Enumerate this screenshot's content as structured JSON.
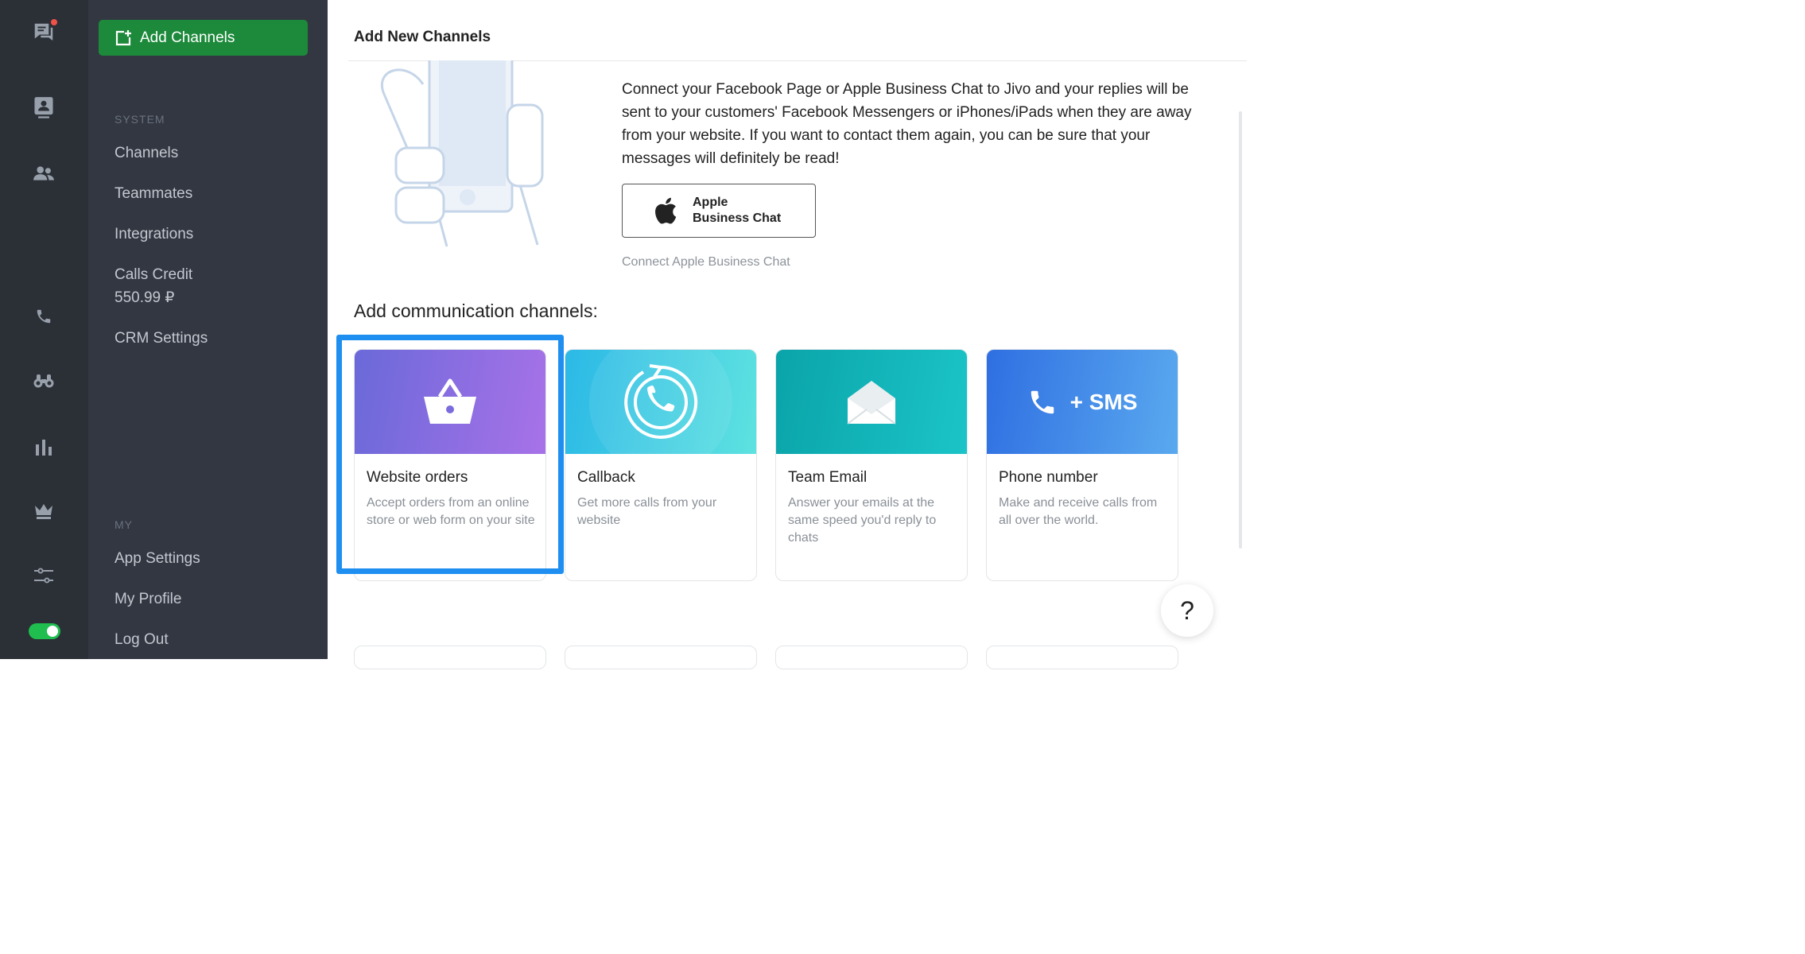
{
  "sidebar": {
    "add_channels_label": "Add Channels",
    "system_heading": "SYSTEM",
    "system_items": [
      "Channels",
      "Teammates",
      "Integrations",
      "Calls Credit",
      "CRM Settings"
    ],
    "calls_credit_amount": "550.99 ₽",
    "my_heading": "MY",
    "my_items": [
      "App Settings",
      "My Profile",
      "Log Out"
    ]
  },
  "rail": {
    "icons": [
      "chat-icon",
      "contacts-icon",
      "team-icon",
      "phone-icon",
      "binoculars-icon",
      "analytics-icon",
      "crown-icon",
      "settings-sliders-icon"
    ],
    "online_toggle": true,
    "notification_dot_color": "#f0524a"
  },
  "main": {
    "title": "Add New Channels",
    "description": "Connect your Facebook Page or Apple Business Chat to Jivo and your replies will be sent to your customers' Facebook Messengers or iPhones/iPads when they are away from your website. If you want to contact them again, you can be sure that your messages will definitely be read!",
    "apple_button": {
      "line1": "Apple",
      "line2": "Business Chat"
    },
    "apple_link": "Connect Apple Business Chat",
    "section_title": "Add communication channels:",
    "cards": [
      {
        "title": "Website orders",
        "desc": "Accept orders from an online store or web form on your site",
        "icon": "basket-icon"
      },
      {
        "title": "Callback",
        "desc": "Get more calls from your website",
        "icon": "callback-icon"
      },
      {
        "title": "Team Email",
        "desc": "Answer your emails at the same speed you'd reply to chats",
        "icon": "envelope-icon"
      },
      {
        "title": "Phone number",
        "desc": "Make and receive calls from all over the world.",
        "icon": "phone-sms-icon",
        "badge": "+ SMS"
      }
    ],
    "help_label": "?",
    "accent_color": "#1d8a3b",
    "highlight_color": "#1e8ff0"
  }
}
